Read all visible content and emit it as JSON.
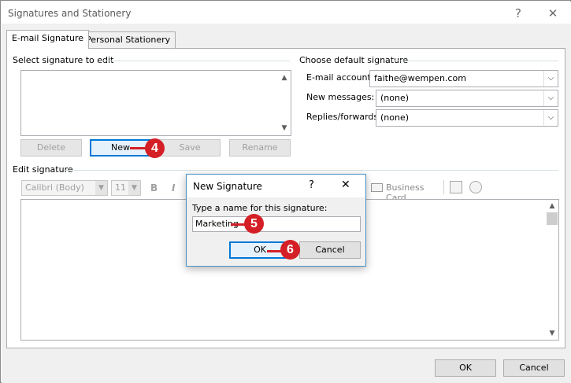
{
  "window": {
    "title": "Signatures and Stationery",
    "help": "?",
    "close": "✕"
  },
  "tabs": [
    {
      "label": "E-mail Signature",
      "underline_index": 0
    },
    {
      "label": "Personal Stationery",
      "underline_index": 0
    }
  ],
  "select_signature": {
    "label": "Select signature to edit",
    "buttons": {
      "delete": "Delete",
      "new": "New",
      "save": "Save",
      "rename": "Rename"
    }
  },
  "default_signature": {
    "label": "Choose default signature",
    "email_account_label": "E-mail account:",
    "email_account_value": "faithe@wempen.com",
    "new_messages_label": "New messages:",
    "new_messages_value": "(none)",
    "replies_label": "Replies/forwards:",
    "replies_value": "(none)"
  },
  "edit_signature": {
    "label": "Edit signature",
    "font": "Calibri (Body)",
    "size": "11",
    "bold": "B",
    "italic": "I",
    "business_card": "Business Card"
  },
  "new_signature_dialog": {
    "title": "New Signature",
    "help": "?",
    "close": "✕",
    "prompt": "Type a name for this signature:",
    "name_value": "Marketing",
    "ok": "OK",
    "cancel": "Cancel"
  },
  "footer": {
    "ok": "OK",
    "cancel": "Cancel"
  },
  "callouts": [
    "4",
    "5",
    "6"
  ],
  "colors": {
    "callout": "#d41f26",
    "focus": "#0078d7",
    "panel_bg": "#f0f0f0"
  }
}
